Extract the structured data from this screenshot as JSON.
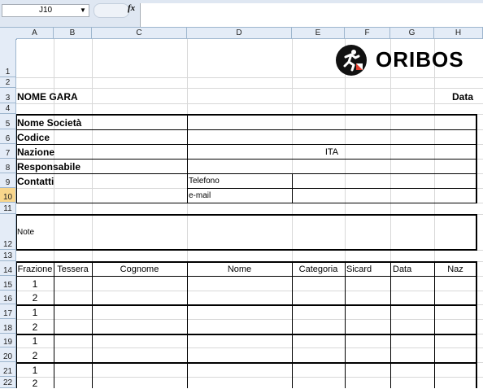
{
  "formula_bar": {
    "name_box": "J10",
    "fx_label": "fx",
    "formula": ""
  },
  "columns": [
    "A",
    "B",
    "C",
    "D",
    "E",
    "F",
    "G",
    "H"
  ],
  "rows": [
    "1",
    "2",
    "3",
    "4",
    "5",
    "6",
    "7",
    "8",
    "9",
    "10",
    "11",
    "12",
    "13",
    "14",
    "15",
    "16",
    "17",
    "18",
    "19",
    "20",
    "21",
    "22"
  ],
  "logo": {
    "text": "ORIBOS"
  },
  "sheet": {
    "nome_gara": "NOME GARA",
    "data": "Data",
    "fields": [
      "Nome Società",
      "Codice",
      "Nazione",
      "Responsabile",
      "Contatti"
    ],
    "nazione_value": "ITA",
    "telefono": "Telefono",
    "email": "e-mail",
    "note": "Note",
    "table_headers": [
      "Frazione",
      "Tessera",
      "Cognome",
      "Nome",
      "Categoria",
      "Sicard",
      "Data",
      "Naz"
    ],
    "frazioni": [
      "1",
      "2",
      "1",
      "2",
      "1",
      "2",
      "1",
      "2"
    ]
  },
  "colors": {
    "header_bg": "#e4ecf7",
    "selected_header": "#f8d68c",
    "grid": "#d8d8d8"
  }
}
